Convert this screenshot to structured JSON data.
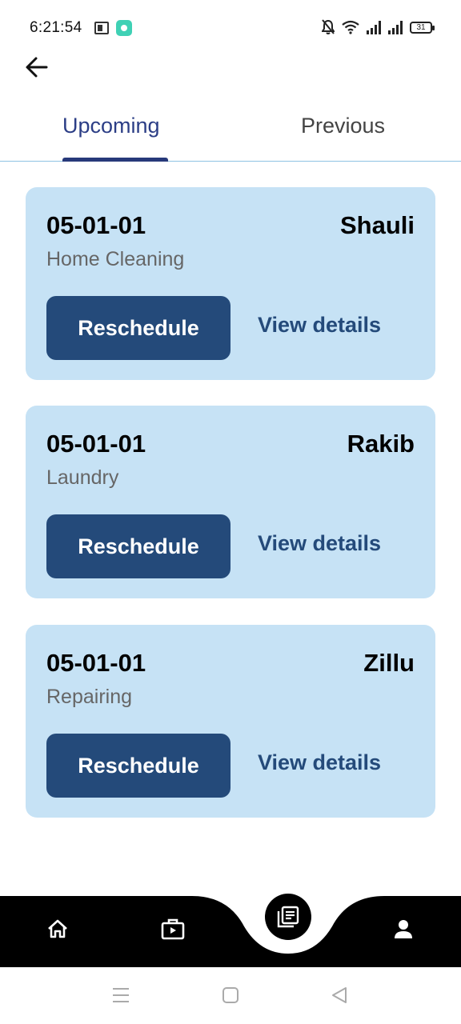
{
  "status_bar": {
    "time": "6:21:54",
    "battery": "31",
    "icons": [
      "sim-icon",
      "app-notification-icon",
      "mute-bell-icon",
      "wifi-icon",
      "signal-icon",
      "signal-icon",
      "battery-icon"
    ]
  },
  "header": {
    "back_icon": "arrow-left-icon"
  },
  "tabs": [
    {
      "label": "Upcoming",
      "active": true
    },
    {
      "label": "Previous",
      "active": false
    }
  ],
  "bookings": [
    {
      "date": "05-01-01",
      "name": "Shauli",
      "service": "Home Cleaning",
      "reschedule_label": "Reschedule",
      "details_label": "View details"
    },
    {
      "date": "05-01-01",
      "name": "Rakib",
      "service": "Laundry",
      "reschedule_label": "Reschedule",
      "details_label": "View details"
    },
    {
      "date": "05-01-01",
      "name": "Zillu",
      "service": "Repairing",
      "reschedule_label": "Reschedule",
      "details_label": "View details"
    }
  ],
  "bottom_nav": {
    "items": [
      {
        "icon": "home-icon",
        "active": false
      },
      {
        "icon": "briefcase-icon",
        "active": false
      },
      {
        "icon": "bookings-icon",
        "active": true
      },
      {
        "icon": "profile-icon",
        "active": false
      }
    ]
  },
  "system_nav": [
    "menu-icon",
    "home-square-icon",
    "back-triangle-icon"
  ],
  "colors": {
    "accent": "#2c3e86",
    "card_bg": "#c6e2f5",
    "button_bg": "#244a7a",
    "nav_bg": "#000000"
  }
}
